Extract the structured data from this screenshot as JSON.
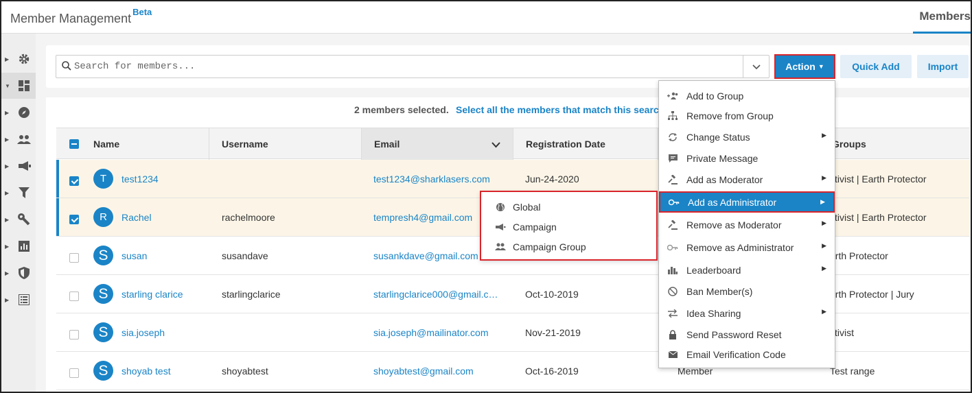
{
  "header": {
    "app_title": "Member Management",
    "beta_badge": "Beta",
    "tab_members": "Members"
  },
  "rail": {
    "items": [
      {
        "icon": "gear-icon"
      },
      {
        "icon": "dashboard-icon"
      },
      {
        "icon": "compass-icon"
      },
      {
        "icon": "people-icon"
      },
      {
        "icon": "megaphone-icon"
      },
      {
        "icon": "filter-icon"
      },
      {
        "icon": "wrench-icon"
      },
      {
        "icon": "bar-chart-icon"
      },
      {
        "icon": "shield-icon"
      },
      {
        "icon": "list-icon"
      }
    ]
  },
  "search": {
    "placeholder": "Search for members...",
    "value": ""
  },
  "toolbar": {
    "action_label": "Action",
    "quick_add_label": "Quick Add",
    "import_label": "Import"
  },
  "selection": {
    "count_text": "2 members selected.",
    "select_all_text": "Select all the members that match this search"
  },
  "table": {
    "columns": {
      "name": "Name",
      "username": "Username",
      "email": "Email",
      "registration_date": "Registration Date",
      "groups": "Groups"
    },
    "rows": [
      {
        "selected": true,
        "initial": "T",
        "name": "test1234",
        "username": "",
        "email": "test1234@sharklasers.com",
        "date": "Jun-24-2020",
        "role": "",
        "groups": "ctivist | Earth Protector"
      },
      {
        "selected": true,
        "initial": "R",
        "name": "Rachel",
        "username": "rachelmoore",
        "email": "tempresh4@gmail.com",
        "date": "",
        "role": "",
        "groups": "ctivist | Earth Protector"
      },
      {
        "selected": false,
        "initial": "S",
        "name": "susan",
        "username": "susandave",
        "email": "susankdave@gmail.com",
        "date": "",
        "role": "",
        "groups": "arth Protector"
      },
      {
        "selected": false,
        "initial": "S",
        "name": "starling clarice",
        "username": "starlingclarice",
        "email": "starlingclarice000@gmail.c…",
        "date": "Oct-10-2019",
        "role": "",
        "groups": "arth Protector | Jury"
      },
      {
        "selected": false,
        "initial": "S",
        "name": "sia.joseph",
        "username": "",
        "email": "sia.joseph@mailinator.com",
        "date": "Nov-21-2019",
        "role": "",
        "groups": "ctivist"
      },
      {
        "selected": false,
        "initial": "S",
        "name": "shoyab test",
        "username": "shoyabtest",
        "email": "shoyabtest@gmail.com",
        "date": "Oct-16-2019",
        "role": "Member",
        "groups": "Test range"
      }
    ]
  },
  "action_menu": {
    "items": [
      {
        "label": "Add to Group",
        "icon": "add-group-icon",
        "has_sub": false
      },
      {
        "label": "Remove from Group",
        "icon": "hierarchy-icon",
        "has_sub": false
      },
      {
        "label": "Change Status",
        "icon": "refresh-icon",
        "has_sub": true
      },
      {
        "label": "Private Message",
        "icon": "message-icon",
        "has_sub": false
      },
      {
        "label": "Add as Moderator",
        "icon": "gavel-icon",
        "has_sub": true
      },
      {
        "label": "Add as Administrator",
        "icon": "key-icon",
        "has_sub": true,
        "highlighted": true
      },
      {
        "label": "Remove as Moderator",
        "icon": "gavel-icon",
        "has_sub": true
      },
      {
        "label": "Remove as Administrator",
        "icon": "key-icon",
        "has_sub": true
      },
      {
        "label": "Leaderboard",
        "icon": "leaderboard-icon",
        "has_sub": true
      },
      {
        "label": "Ban Member(s)",
        "icon": "ban-icon",
        "has_sub": false
      },
      {
        "label": "Idea Sharing",
        "icon": "swap-icon",
        "has_sub": true
      },
      {
        "label": "Send Password Reset",
        "icon": "lock-icon",
        "has_sub": false
      },
      {
        "label": "Email Verification Code",
        "icon": "envelope-icon",
        "has_sub": false
      }
    ]
  },
  "admin_submenu": {
    "items": [
      {
        "label": "Global",
        "icon": "globe-icon"
      },
      {
        "label": "Campaign",
        "icon": "megaphone-icon"
      },
      {
        "label": "Campaign Group",
        "icon": "people-icon"
      }
    ]
  },
  "colors": {
    "accent": "#1a84c7",
    "highlight_border": "#d9242b",
    "selected_row": "#fcf5e7"
  }
}
